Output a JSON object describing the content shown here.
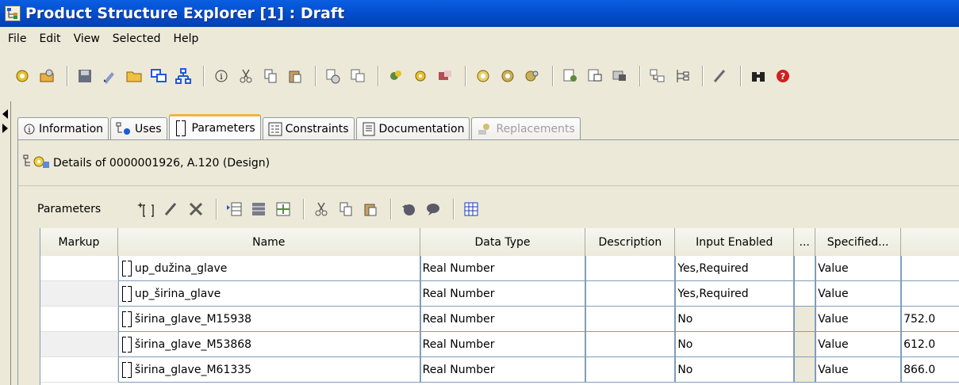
{
  "window": {
    "title": "Product Structure Explorer [1] : Draft"
  },
  "menu": [
    "File",
    "Edit",
    "View",
    "Selected",
    "Help"
  ],
  "tabs": [
    {
      "label": "Information",
      "icon": "info-icon",
      "state": "normal"
    },
    {
      "label": "Uses",
      "icon": "uses-icon",
      "state": "normal"
    },
    {
      "label": "Parameters",
      "icon": "parameters-icon",
      "state": "active"
    },
    {
      "label": "Constraints",
      "icon": "constraints-icon",
      "state": "normal"
    },
    {
      "label": "Documentation",
      "icon": "documentation-icon",
      "state": "normal"
    },
    {
      "label": "Replacements",
      "icon": "replacements-icon",
      "state": "disabled"
    }
  ],
  "details": {
    "text": "Details of 0000001926, A.120 (Design)"
  },
  "parameters": {
    "label": "Parameters",
    "columns": [
      "Markup",
      "Name",
      "Data Type",
      "Description",
      "Input Enabled",
      "...",
      "Specified...",
      ""
    ],
    "rows": [
      {
        "markup": "",
        "name": "up_dužina_glave",
        "data_type": "Real Number",
        "description": "",
        "input_enabled": "Yes,Required",
        "extra": "",
        "specified": "Value",
        "value": ""
      },
      {
        "markup": "",
        "name": "up_širina_glave",
        "data_type": "Real Number",
        "description": "",
        "input_enabled": "Yes,Required",
        "extra": "",
        "specified": "Value",
        "value": ""
      },
      {
        "markup": "",
        "name": "širina_glave_M15938",
        "data_type": "Real Number",
        "description": "",
        "input_enabled": "No",
        "extra": "",
        "specified": "Value",
        "value": "752.0"
      },
      {
        "markup": "",
        "name": "širina_glave_M53868",
        "data_type": "Real Number",
        "description": "",
        "input_enabled": "No",
        "extra": "",
        "specified": "Value",
        "value": "612.0"
      },
      {
        "markup": "",
        "name": "širina_glave_M61335",
        "data_type": "Real Number",
        "description": "",
        "input_enabled": "No",
        "extra": "",
        "specified": "Value",
        "value": "866.0"
      }
    ]
  },
  "colors": {
    "title_bar": "#0554d6",
    "active_tab_accent": "#f7b23a",
    "chrome": "#ece9d8",
    "cell_border": "#7f9db9"
  }
}
